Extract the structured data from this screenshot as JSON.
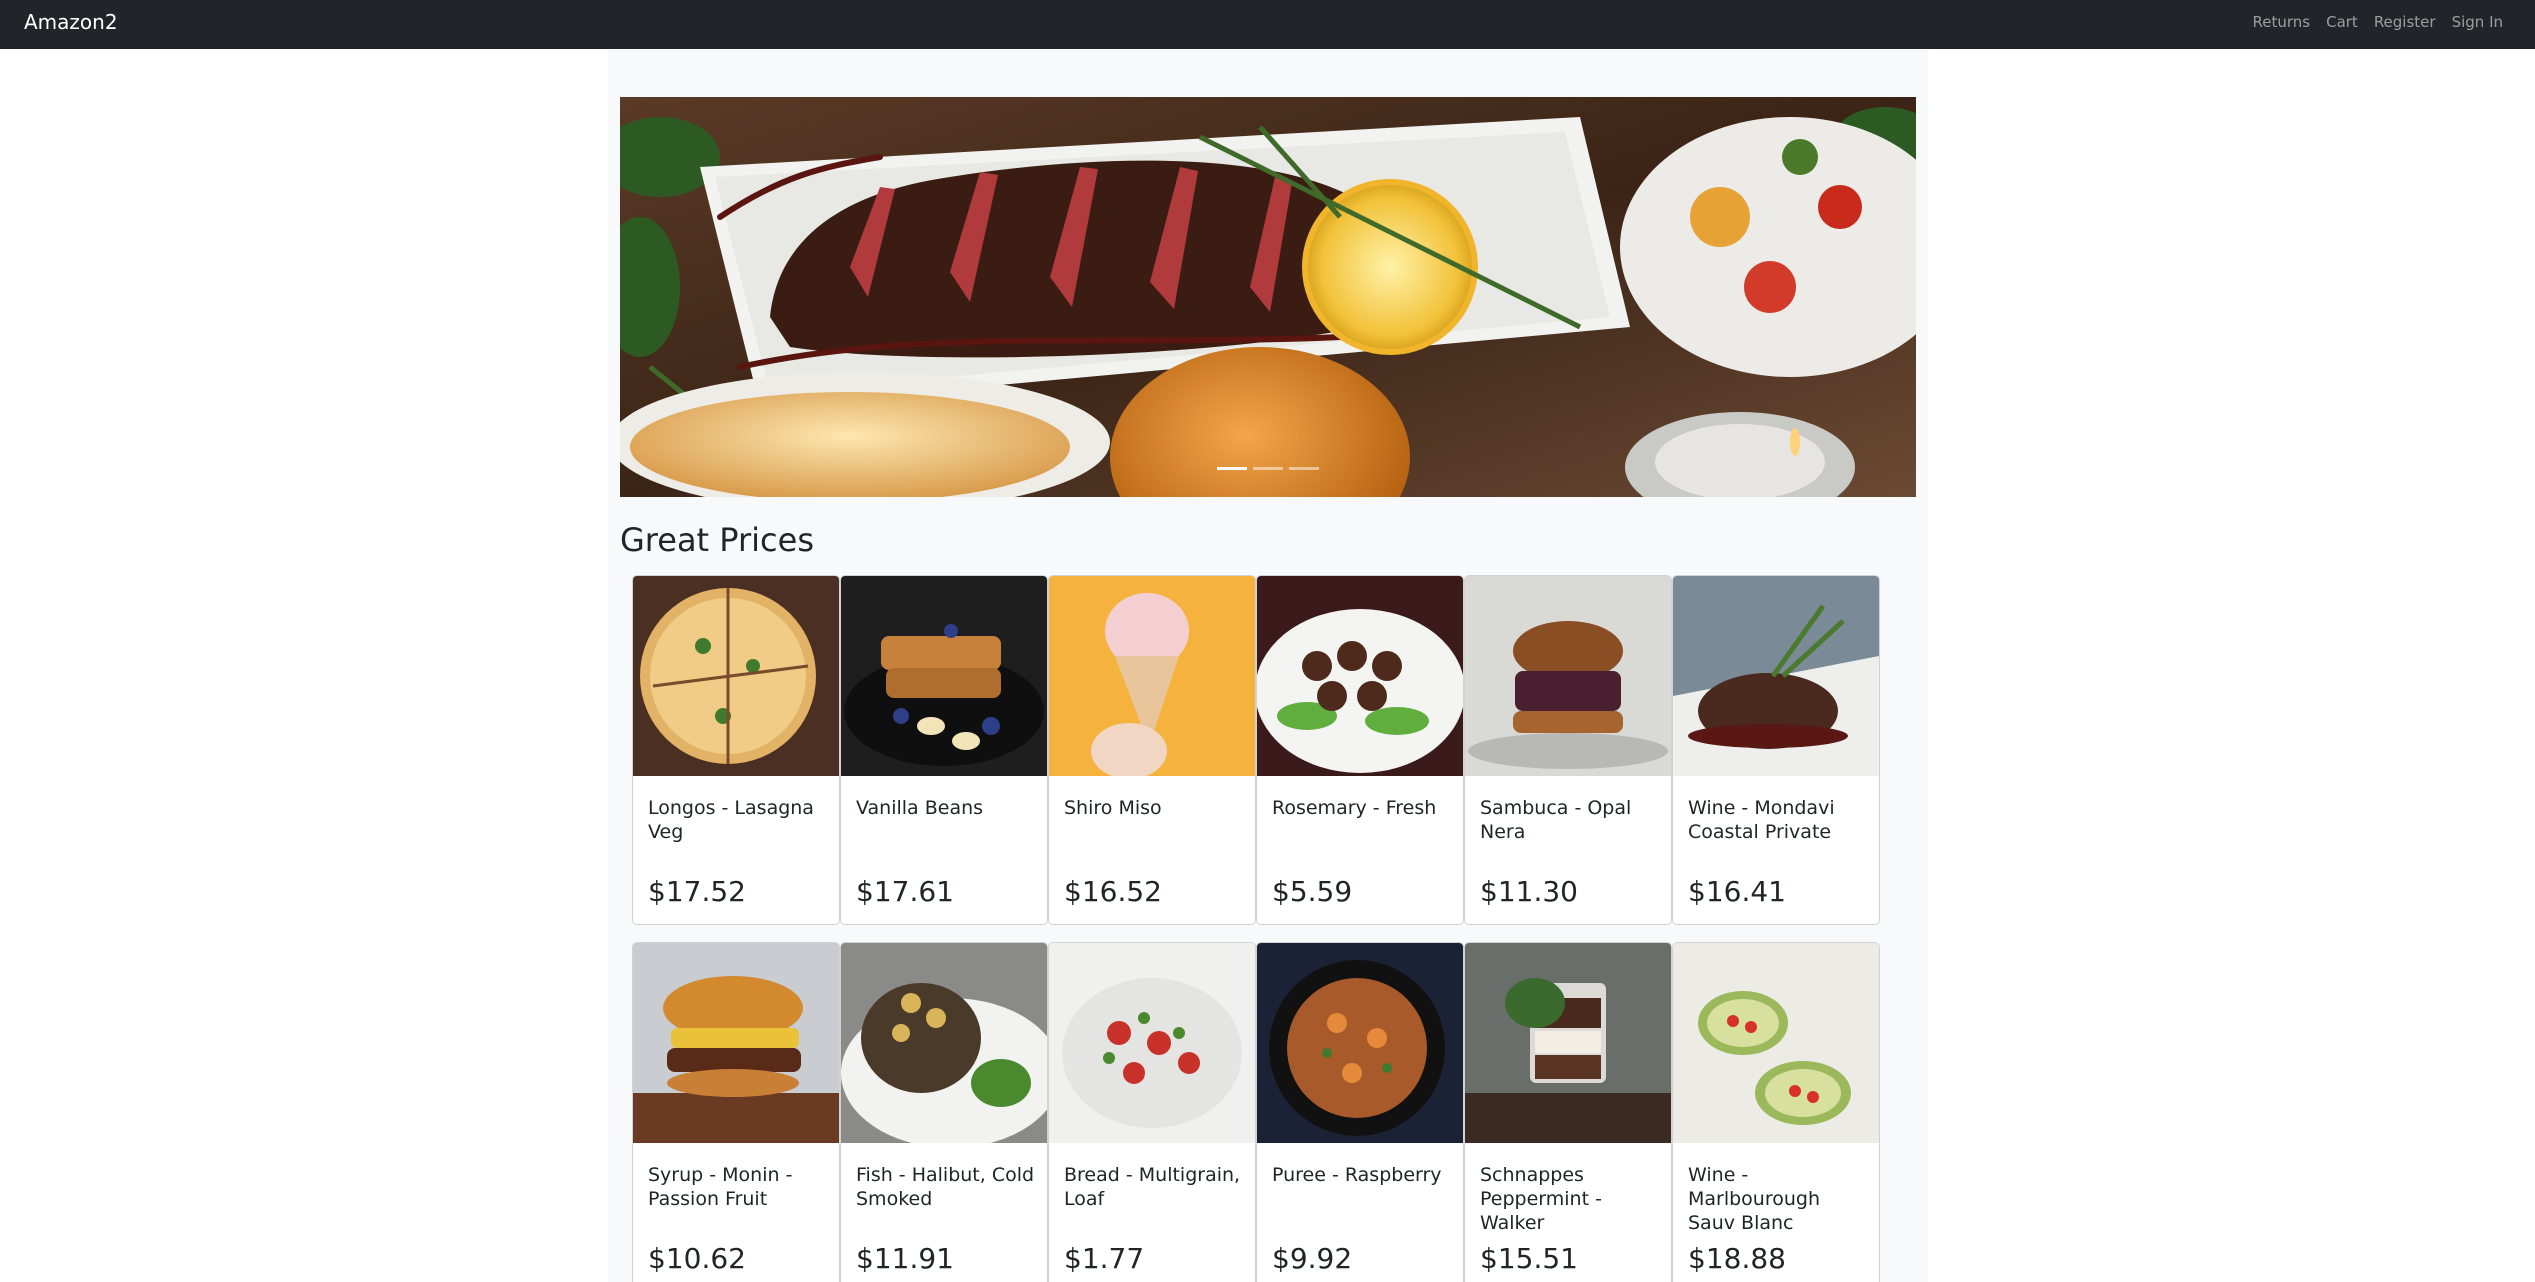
{
  "navbar": {
    "brand": "Amazon2",
    "links": [
      "Returns",
      "Cart",
      "Register",
      "Sign In"
    ]
  },
  "carousel": {
    "slide_count": 3,
    "active_slide": 1
  },
  "section_title": "Great Prices",
  "products": [
    {
      "name": "Longos - Lasagna Veg",
      "price": "$17.52"
    },
    {
      "name": "Vanilla Beans",
      "price": "$17.61"
    },
    {
      "name": "Shiro Miso",
      "price": "$16.52"
    },
    {
      "name": "Rosemary - Fresh",
      "price": "$5.59"
    },
    {
      "name": "Sambuca - Opal Nera",
      "price": "$11.30"
    },
    {
      "name": "Wine - Mondavi Coastal Private",
      "price": "$16.41"
    },
    {
      "name": "Syrup - Monin - Passion Fruit",
      "price": "$10.62"
    },
    {
      "name": "Fish - Halibut, Cold Smoked",
      "price": "$11.91"
    },
    {
      "name": "Bread - Multigrain, Loaf",
      "price": "$1.77"
    },
    {
      "name": "Puree - Raspberry",
      "price": "$9.92"
    },
    {
      "name": "Schnappes Peppermint - Walker",
      "price": "$15.51"
    },
    {
      "name": "Wine - Marlbourough Sauv Blanc",
      "price": "$18.88"
    }
  ],
  "colors": {
    "navbar_bg": "#212529",
    "page_bg": "#f8f9fa",
    "text": "#212529"
  }
}
